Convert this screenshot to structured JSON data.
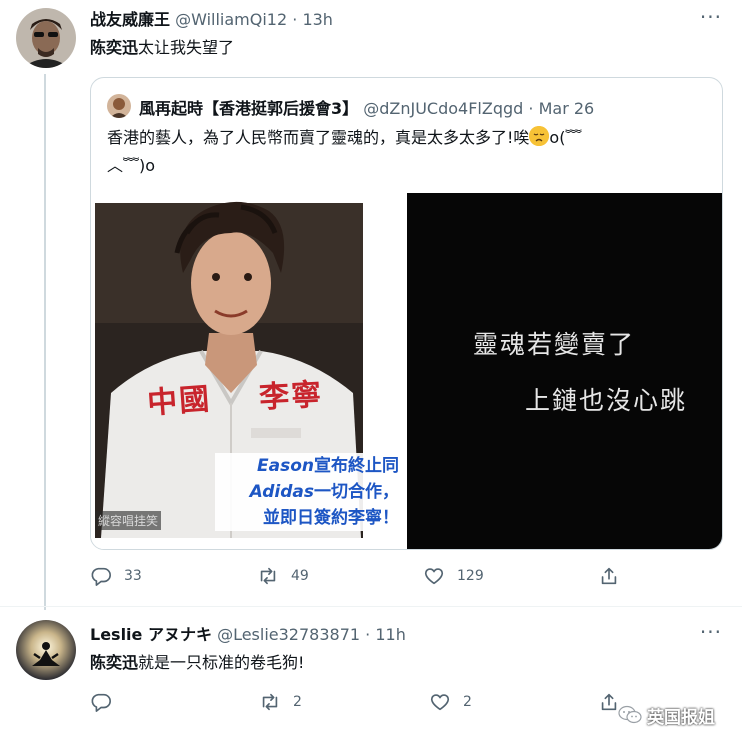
{
  "tweet1": {
    "display_name": "战友威廉王",
    "handle": "@WilliamQi12",
    "time": "13h",
    "text_bold": "陈奕迅",
    "text_rest": "太让我失望了",
    "quote": {
      "display_name": "風再起時【香港挺郭后援會3】",
      "handle": "@dZnJUCdo4FlZqgd",
      "date": "Mar 26",
      "text_line1": "香港的藝人，為了人民幣而賣了靈魂的，真是太多太多了!唉",
      "text_line1_tail": "o(﹌",
      "text_line2": "︿﹌)o",
      "image_left": {
        "overlay_line1_en": "Eason",
        "overlay_line1_zh": "宣布終止同",
        "overlay_line2_en": "Adidas",
        "overlay_line2_zh": "一切合作，",
        "overlay_line3": "並即日簽約李寧！",
        "shirt_left": "中國",
        "shirt_right": "李寧",
        "watermark": "縱容唱挂笑"
      },
      "image_right": {
        "line1": "靈魂若變賣了",
        "line2": "上鏈也沒心跳"
      }
    },
    "actions": {
      "replies": "33",
      "retweets": "49",
      "likes": "129"
    }
  },
  "tweet2": {
    "display_name": "Leslie アヌナキ",
    "handle": "@Leslie32783871",
    "time": "11h",
    "text_bold": "陈奕迅",
    "text_rest": "就是一只标准的卷毛狗!",
    "actions": {
      "replies": "",
      "retweets": "2",
      "likes": "2"
    }
  },
  "watermark": {
    "text": "英国报姐"
  },
  "colors": {
    "text": "#0f1419",
    "secondary": "#536471",
    "border": "#cfd9de",
    "shirt_red": "#c8242c",
    "overlay_blue": "#1d56c4"
  }
}
